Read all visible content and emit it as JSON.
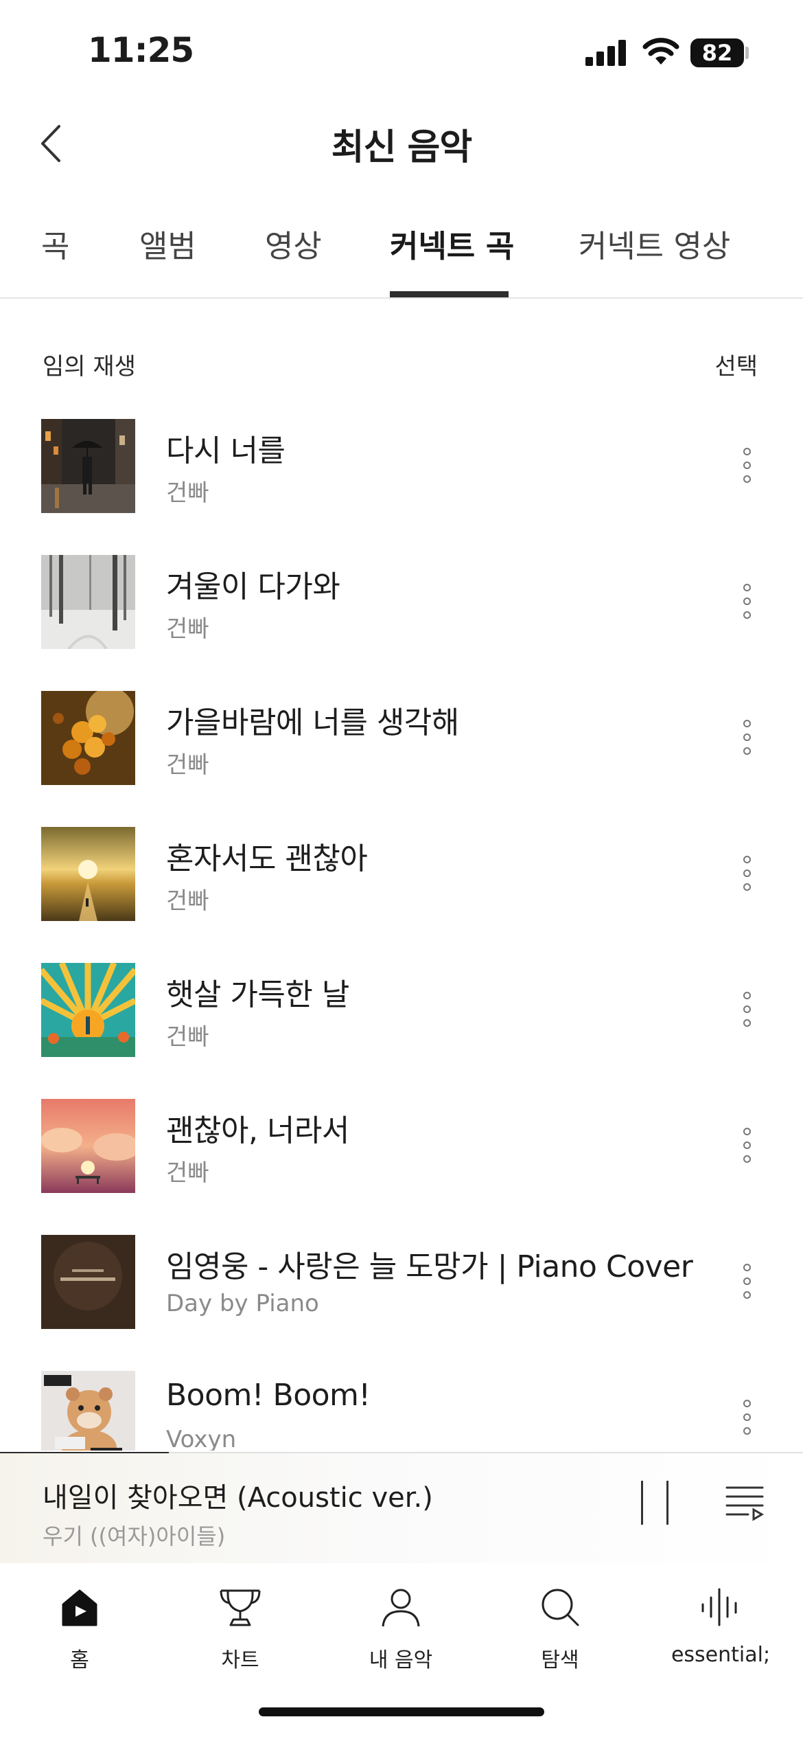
{
  "status_bar": {
    "time": "11:25",
    "battery": "82"
  },
  "header": {
    "title": "최신 음악"
  },
  "tabs": [
    {
      "label": "곡"
    },
    {
      "label": "앨범"
    },
    {
      "label": "영상"
    },
    {
      "label": "커넥트 곡",
      "active": true
    },
    {
      "label": "커넥트 영상"
    }
  ],
  "controls": {
    "shuffle_label": "임의 재생",
    "select_label": "선택"
  },
  "songs": [
    {
      "title": "다시 너를",
      "artist": "건빠",
      "art": "rainy-street-umbrella"
    },
    {
      "title": "겨울이 다가와",
      "artist": "건빠",
      "art": "snowy-forest"
    },
    {
      "title": "가을바람에 너를 생각해",
      "artist": "건빠",
      "art": "autumn-leaves"
    },
    {
      "title": "혼자서도 괜찮아",
      "artist": "건빠",
      "art": "sunset-road"
    },
    {
      "title": "햇살 가득한 날",
      "artist": "건빠",
      "art": "sunburst-flowers"
    },
    {
      "title": "괜찮아, 너라서",
      "artist": "건빠",
      "art": "pink-sky-bench"
    },
    {
      "title": "임영웅 - 사랑은 늘 도망가 | Piano Cover",
      "artist": "Day by Piano",
      "art": "dark-piano-cover"
    },
    {
      "title": "Boom! Boom!",
      "artist": "Voxyn",
      "art": "cartoon-hamster"
    }
  ],
  "now_playing": {
    "title": "내일이 찾아오면 (Acoustic ver.)",
    "artist": "우기 ((여자)아이들)",
    "progress": 0.21
  },
  "bottom_nav": [
    {
      "label": "홈",
      "icon": "home-icon",
      "active": true
    },
    {
      "label": "차트",
      "icon": "trophy-icon"
    },
    {
      "label": "내 음악",
      "icon": "person-icon"
    },
    {
      "label": "탐색",
      "icon": "search-icon"
    },
    {
      "label": "essential;",
      "icon": "soundwave-icon"
    }
  ],
  "colors": {
    "text": "#1c1c1c",
    "muted": "#8a8a8a",
    "indicator": "#2d2d2d"
  }
}
